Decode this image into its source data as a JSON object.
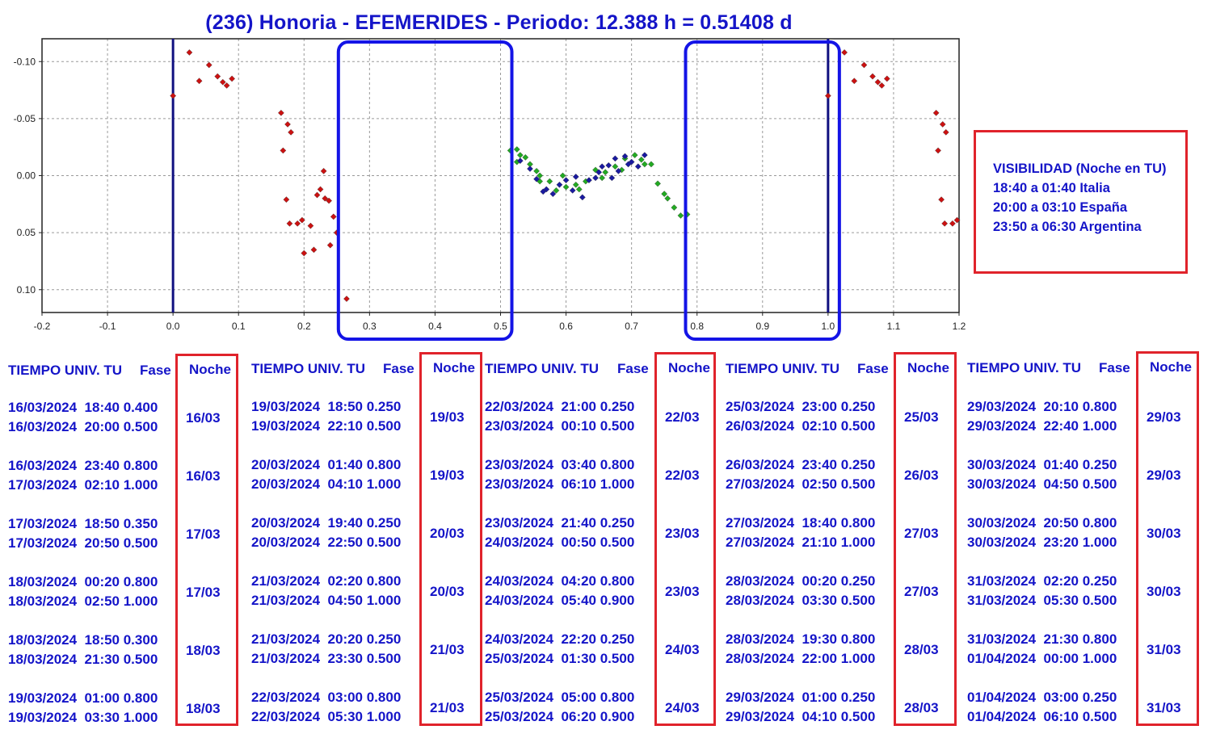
{
  "title": "(236) Honoria  - EFEMERIDES - Periodo: 12.388 h = 0.51408 d",
  "visibility": {
    "heading": "VISIBILIDAD (Noche en TU)",
    "lines": [
      "18:40 a 01:40 Italia",
      "20:00 a 03:10 España",
      "23:50 a 06:30 Argentina"
    ]
  },
  "chart_data": {
    "type": "scatter",
    "title": "(236) Honoria  - EFEMERIDES - Periodo: 12.388 h = 0.51408 d",
    "xlabel": "",
    "ylabel": "",
    "xlim": [
      -0.2,
      1.2
    ],
    "ylim": [
      -0.12,
      0.12
    ],
    "y_inverted": true,
    "grid": true,
    "x_ticks": [
      "-0.2",
      "-0.1",
      "0.0",
      "0.1",
      "0.2",
      "0.3",
      "0.4",
      "0.5",
      "0.6",
      "0.7",
      "0.8",
      "0.9",
      "1.0",
      "1.1",
      "1.2"
    ],
    "y_ticks": [
      "-0.10",
      "-0.05",
      "0.00",
      "0.05",
      "0.10"
    ],
    "colors": {
      "red": "#cc1111",
      "green": "#22aa22",
      "blue": "#1a1aa0",
      "frame": "#1414c8",
      "nightline": "#101080"
    },
    "series": [
      {
        "color": "red",
        "points": [
          [
            0.0,
            -0.07
          ],
          [
            0.025,
            -0.108
          ],
          [
            0.04,
            -0.083
          ],
          [
            0.055,
            -0.097
          ],
          [
            0.068,
            -0.087
          ],
          [
            0.076,
            -0.082
          ],
          [
            0.082,
            -0.079
          ],
          [
            0.09,
            -0.085
          ],
          [
            0.165,
            -0.055
          ],
          [
            0.168,
            -0.022
          ],
          [
            0.175,
            -0.045
          ],
          [
            0.18,
            -0.038
          ],
          [
            0.173,
            0.021
          ],
          [
            0.178,
            0.042
          ],
          [
            0.19,
            0.042
          ],
          [
            0.197,
            0.039
          ],
          [
            0.2,
            0.068
          ],
          [
            0.21,
            0.044
          ],
          [
            0.215,
            0.065
          ],
          [
            0.22,
            0.017
          ],
          [
            0.23,
            -0.004
          ],
          [
            0.225,
            0.012
          ],
          [
            0.232,
            0.02
          ],
          [
            0.238,
            0.022
          ],
          [
            0.24,
            0.061
          ],
          [
            0.245,
            0.036
          ],
          [
            0.25,
            0.05
          ],
          [
            0.265,
            0.108
          ]
        ]
      },
      {
        "color": "green",
        "points": [
          [
            0.515,
            -0.022
          ],
          [
            0.525,
            -0.023
          ],
          [
            0.53,
            -0.018
          ],
          [
            0.538,
            -0.016
          ],
          [
            0.545,
            -0.01
          ],
          [
            0.555,
            -0.004
          ],
          [
            0.56,
            0.0
          ],
          [
            0.575,
            0.005
          ],
          [
            0.585,
            0.013
          ],
          [
            0.6,
            0.01
          ],
          [
            0.615,
            0.008
          ],
          [
            0.63,
            0.005
          ],
          [
            0.645,
            -0.005
          ],
          [
            0.66,
            -0.003
          ],
          [
            0.675,
            -0.008
          ],
          [
            0.69,
            -0.015
          ],
          [
            0.705,
            -0.018
          ],
          [
            0.715,
            -0.014
          ],
          [
            0.72,
            -0.01
          ],
          [
            0.73,
            -0.01
          ],
          [
            0.74,
            0.007
          ],
          [
            0.75,
            0.016
          ],
          [
            0.755,
            0.02
          ],
          [
            0.765,
            0.028
          ],
          [
            0.775,
            0.035
          ],
          [
            0.785,
            0.034
          ],
          [
            0.525,
            -0.012
          ],
          [
            0.56,
            0.005
          ],
          [
            0.595,
            0.0
          ],
          [
            0.62,
            0.012
          ],
          [
            0.655,
            0.002
          ],
          [
            0.685,
            -0.005
          ]
        ]
      },
      {
        "color": "blue",
        "points": [
          [
            0.53,
            -0.013
          ],
          [
            0.545,
            -0.006
          ],
          [
            0.555,
            0.003
          ],
          [
            0.57,
            0.012
          ],
          [
            0.58,
            0.016
          ],
          [
            0.59,
            0.008
          ],
          [
            0.6,
            0.004
          ],
          [
            0.61,
            0.013
          ],
          [
            0.625,
            0.019
          ],
          [
            0.635,
            0.004
          ],
          [
            0.645,
            0.002
          ],
          [
            0.655,
            -0.008
          ],
          [
            0.665,
            -0.009
          ],
          [
            0.675,
            -0.015
          ],
          [
            0.68,
            -0.004
          ],
          [
            0.69,
            -0.017
          ],
          [
            0.7,
            -0.012
          ],
          [
            0.71,
            -0.008
          ],
          [
            0.72,
            -0.018
          ],
          [
            0.565,
            0.014
          ],
          [
            0.615,
            0.001
          ],
          [
            0.65,
            -0.003
          ],
          [
            0.67,
            0.002
          ],
          [
            0.695,
            -0.01
          ]
        ]
      },
      {
        "color": "red",
        "points": [
          [
            1.0,
            -0.07
          ],
          [
            1.025,
            -0.108
          ],
          [
            1.04,
            -0.083
          ],
          [
            1.055,
            -0.097
          ],
          [
            1.068,
            -0.087
          ],
          [
            1.076,
            -0.082
          ],
          [
            1.082,
            -0.079
          ],
          [
            1.09,
            -0.085
          ],
          [
            1.165,
            -0.055
          ],
          [
            1.168,
            -0.022
          ],
          [
            1.175,
            -0.045
          ],
          [
            1.18,
            -0.038
          ],
          [
            1.173,
            0.021
          ],
          [
            1.178,
            0.042
          ],
          [
            1.19,
            0.042
          ],
          [
            1.197,
            0.039
          ]
        ]
      }
    ],
    "night_lines": [
      0.0,
      1.0
    ],
    "windows": [
      [
        0.25,
        0.5
      ],
      [
        0.78,
        1.0
      ]
    ]
  },
  "table": {
    "col_header_tiempo": "TIEMPO UNIV. TU",
    "col_header_fase": "Fase",
    "col_header_noche": "Noche",
    "columns": [
      {
        "rows": [
          {
            "l1": "16/03/2024  18:40 0.400",
            "l2": "16/03/2024  20:00 0.500",
            "noche": "16/03"
          },
          {
            "l1": "16/03/2024  23:40 0.800",
            "l2": "17/03/2024  02:10 1.000",
            "noche": "16/03"
          },
          {
            "l1": "17/03/2024  18:50 0.350",
            "l2": "17/03/2024  20:50 0.500",
            "noche": "17/03"
          },
          {
            "l1": "18/03/2024  00:20 0.800",
            "l2": "18/03/2024  02:50 1.000",
            "noche": "17/03"
          },
          {
            "l1": "18/03/2024  18:50 0.300",
            "l2": "18/03/2024  21:30 0.500",
            "noche": "18/03"
          },
          {
            "l1": "19/03/2024  01:00 0.800",
            "l2": "19/03/2024  03:30 1.000",
            "noche": "18/03"
          }
        ]
      },
      {
        "rows": [
          {
            "l1": "19/03/2024  18:50 0.250",
            "l2": "19/03/2024  22:10 0.500",
            "noche": "19/03"
          },
          {
            "l1": "20/03/2024  01:40 0.800",
            "l2": "20/03/2024  04:10 1.000",
            "noche": "19/03"
          },
          {
            "l1": "20/03/2024  19:40 0.250",
            "l2": "20/03/2024  22:50 0.500",
            "noche": "20/03"
          },
          {
            "l1": "21/03/2024  02:20 0.800",
            "l2": "21/03/2024  04:50 1.000",
            "noche": "20/03"
          },
          {
            "l1": "21/03/2024  20:20 0.250",
            "l2": "21/03/2024  23:30 0.500",
            "noche": "21/03"
          },
          {
            "l1": "22/03/2024  03:00 0.800",
            "l2": "22/03/2024  05:30 1.000",
            "noche": "21/03"
          }
        ]
      },
      {
        "rows": [
          {
            "l1": "22/03/2024  21:00 0.250",
            "l2": "23/03/2024  00:10 0.500",
            "noche": "22/03"
          },
          {
            "l1": "23/03/2024  03:40 0.800",
            "l2": "23/03/2024  06:10 1.000",
            "noche": "22/03"
          },
          {
            "l1": "23/03/2024  21:40 0.250",
            "l2": "24/03/2024  00:50 0.500",
            "noche": "23/03"
          },
          {
            "l1": "24/03/2024  04:20 0.800",
            "l2": "24/03/2024  05:40 0.900",
            "noche": "23/03"
          },
          {
            "l1": "24/03/2024  22:20 0.250",
            "l2": "25/03/2024  01:30 0.500",
            "noche": "24/03"
          },
          {
            "l1": "25/03/2024  05:00 0.800",
            "l2": "25/03/2024  06:20 0.900",
            "noche": "24/03"
          }
        ]
      },
      {
        "rows": [
          {
            "l1": "25/03/2024  23:00 0.250",
            "l2": "26/03/2024  02:10 0.500",
            "noche": "25/03"
          },
          {
            "l1": "26/03/2024  23:40 0.250",
            "l2": "27/03/2024  02:50 0.500",
            "noche": "26/03"
          },
          {
            "l1": "27/03/2024  18:40 0.800",
            "l2": "27/03/2024  21:10 1.000",
            "noche": "27/03"
          },
          {
            "l1": "28/03/2024  00:20 0.250",
            "l2": "28/03/2024  03:30 0.500",
            "noche": "27/03"
          },
          {
            "l1": "28/03/2024  19:30 0.800",
            "l2": "28/03/2024  22:00 1.000",
            "noche": "28/03"
          },
          {
            "l1": "29/03/2024  01:00 0.250",
            "l2": "29/03/2024  04:10 0.500",
            "noche": "28/03"
          }
        ]
      },
      {
        "rows": [
          {
            "l1": "29/03/2024  20:10 0.800",
            "l2": "29/03/2024  22:40 1.000",
            "noche": "29/03"
          },
          {
            "l1": "30/03/2024  01:40 0.250",
            "l2": "30/03/2024  04:50 0.500",
            "noche": "29/03"
          },
          {
            "l1": "30/03/2024  20:50 0.800",
            "l2": "30/03/2024  23:20 1.000",
            "noche": "30/03"
          },
          {
            "l1": "31/03/2024  02:20 0.250",
            "l2": "31/03/2024  05:30 0.500",
            "noche": "30/03"
          },
          {
            "l1": "31/03/2024  21:30 0.800",
            "l2": "01/04/2024  00:00 1.000",
            "noche": "31/03"
          },
          {
            "l1": "01/04/2024  03:00 0.250",
            "l2": "01/04/2024  06:10 0.500",
            "noche": "31/03"
          }
        ]
      }
    ]
  }
}
